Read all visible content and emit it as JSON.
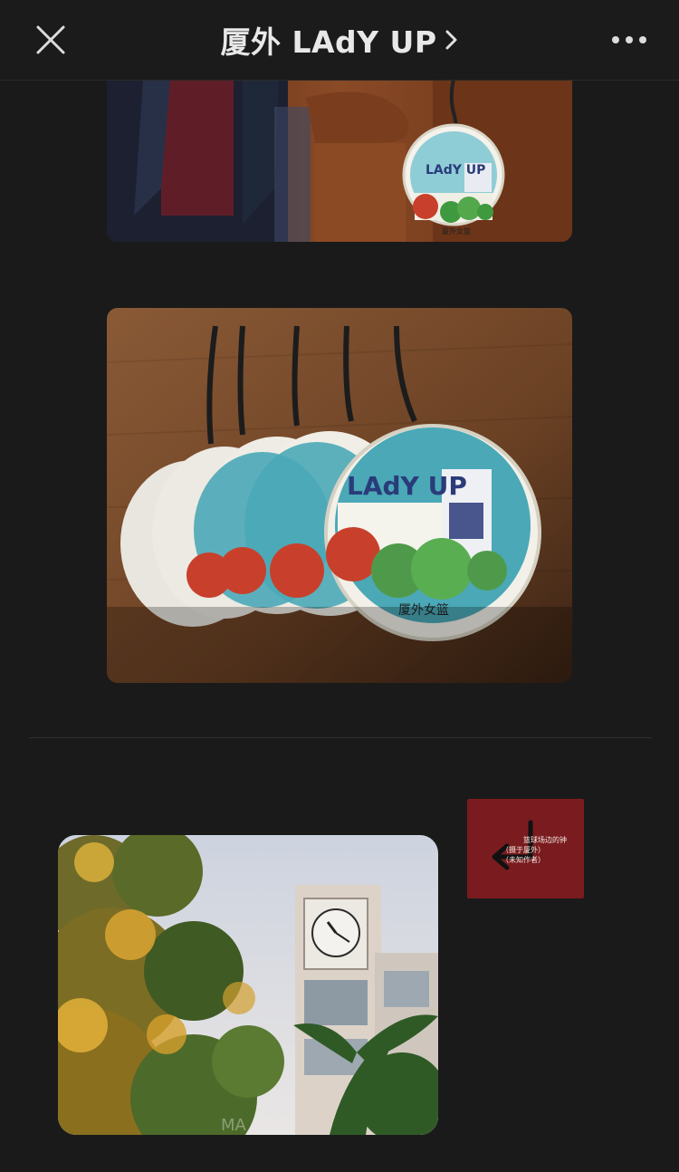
{
  "header": {
    "title": "厦外 LAdY UP",
    "close_icon": "close-icon",
    "chevron_icon": "chevron-right-icon",
    "more_icon": "more-dots-icon"
  },
  "images": {
    "keychain_hanging": {
      "badge_text": "LAdY UP",
      "caption_cn": "厦外女篮"
    },
    "keychains_row": {
      "badge_text": "LAdY UP",
      "caption_cn": "厦外女篮"
    },
    "clock_tower": {
      "watermark": "MA"
    }
  },
  "thumbnail": {
    "line1": "篮球场边的钟",
    "line2": "（摄于厦外）",
    "line3": "（未知作者）",
    "icon": "return-arrow-icon"
  },
  "colors": {
    "background": "#1a1a1a",
    "thumb_bg": "#7a1c1f",
    "badge_teal": "#4aa8b7",
    "ball_orange": "#c8402b",
    "tree_green": "#4f9a4a"
  }
}
